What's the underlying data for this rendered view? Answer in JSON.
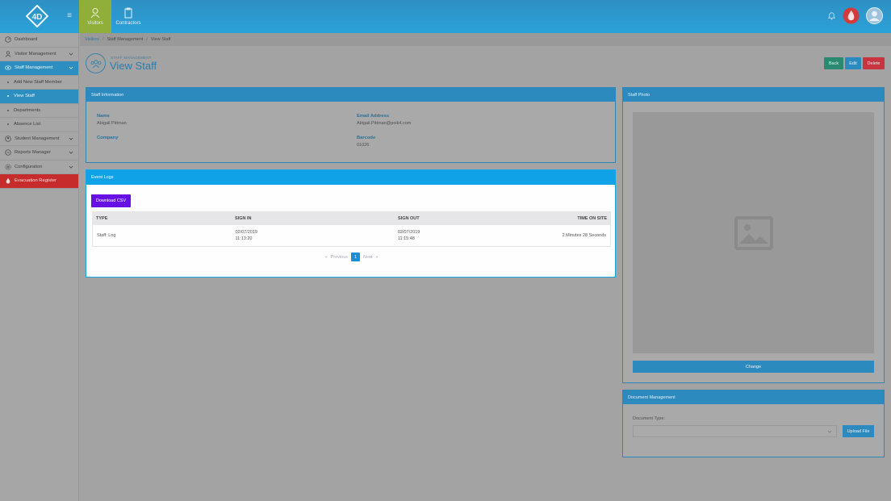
{
  "header": {
    "tabs": [
      {
        "label": "Visitors"
      },
      {
        "label": "Contractors"
      }
    ]
  },
  "sidebar": {
    "items": [
      {
        "label": "Dashboard"
      },
      {
        "label": "Visitor Management"
      },
      {
        "label": "Staff Management"
      },
      {
        "label": "Add New Staff Member"
      },
      {
        "label": "View Staff"
      },
      {
        "label": "Departments"
      },
      {
        "label": "Absence List"
      },
      {
        "label": "Student Management"
      },
      {
        "label": "Reports Manager"
      },
      {
        "label": "Configuration"
      },
      {
        "label": "Evacuation Register"
      }
    ]
  },
  "breadcrumb": [
    "Visitors",
    "Staff Management",
    "View Staff"
  ],
  "page": {
    "supertitle": "STAFF MANAGEMENT",
    "title": "View Staff",
    "actions": {
      "back": "Back",
      "edit": "Edit",
      "delete": "Delete"
    },
    "colors": {
      "back": "#2a8a70",
      "edit": "#2d8abf",
      "delete": "#c8343f"
    }
  },
  "staff_info": {
    "heading": "Staff Information",
    "name_label": "Name",
    "name_value": "Abigail Pittman",
    "email_label": "Email Address",
    "email_value": "Abigail.Pittman@poik4.com",
    "company_label": "Company",
    "company_value": "",
    "barcode_label": "Barcode",
    "barcode_value": "01026"
  },
  "event_logs": {
    "heading": "Event Logs",
    "download_label": "Download CSV",
    "columns": [
      "TYPE",
      "SIGN IN",
      "SIGN OUT",
      "TIME ON SITE"
    ],
    "rows": [
      {
        "type": "Staff: Log",
        "sign_in_date": "02/07/2019",
        "sign_in_time": "11:13:20",
        "sign_out_date": "02/07/2019",
        "sign_out_time": "11:15:48",
        "time_on_site": "2 Minutes 28 Seconds"
      }
    ],
    "pagination": {
      "prev": "Previous",
      "current": "1",
      "next": "Next"
    }
  },
  "staff_photo": {
    "heading": "Staff Photo",
    "change_label": "Change"
  },
  "documents": {
    "heading": "Document Management",
    "type_label": "Document Type:",
    "upload_label": "Upload File"
  }
}
